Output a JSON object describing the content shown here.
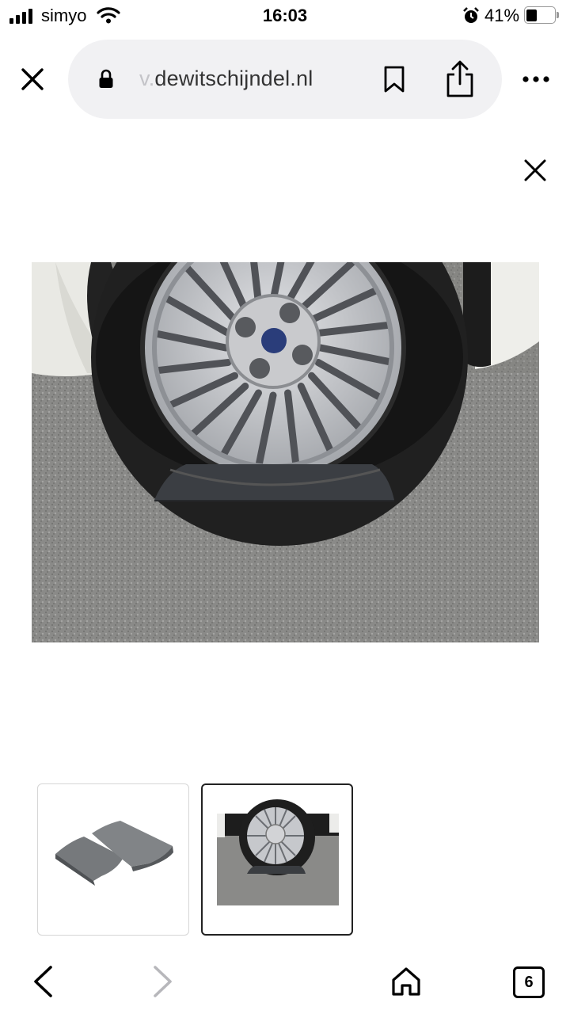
{
  "status_bar": {
    "carrier": "simyo",
    "time": "16:03",
    "battery_percent": "41%",
    "battery_level": 0.41
  },
  "browser": {
    "url_prefix": "v.",
    "url_domain": "dewitschijndel.nl",
    "icons": [
      "close-icon",
      "lock-icon",
      "bookmark-icon",
      "share-icon",
      "more-icon"
    ]
  },
  "viewer": {
    "close_icon": "close-icon",
    "main_image": "tire-on-leveling-ramp-photo",
    "thumbnails": [
      {
        "image": "two-grey-leveling-ramps",
        "selected": false
      },
      {
        "image": "tire-on-leveling-ramp-photo",
        "selected": true
      }
    ]
  },
  "toolbar": {
    "tab_count": "6",
    "icons": [
      "back-icon",
      "forward-icon",
      "home-icon",
      "tabs-icon"
    ]
  }
}
